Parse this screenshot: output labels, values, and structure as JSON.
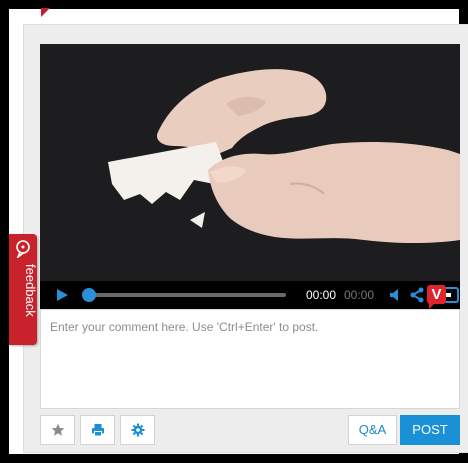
{
  "player": {
    "time_current": "00:00",
    "time_duration": "00:00",
    "progress": 0
  },
  "branding": {
    "logo_letter": "V"
  },
  "comment": {
    "placeholder": "Enter your comment here. Use 'Ctrl+Enter' to post."
  },
  "toolbar": {
    "favorite_icon": "star-icon",
    "print_icon": "printer-icon",
    "settings_icon": "gear-icon",
    "qa_label": "Q&A",
    "post_label": "POST"
  },
  "feedback": {
    "label": "feedback",
    "icon": "speech-bubble-icon"
  },
  "colors": {
    "accent_blue": "#1a90d6",
    "feedback_red": "#c8222c",
    "logo_red": "#e0242b",
    "control_bar": "#000000"
  }
}
